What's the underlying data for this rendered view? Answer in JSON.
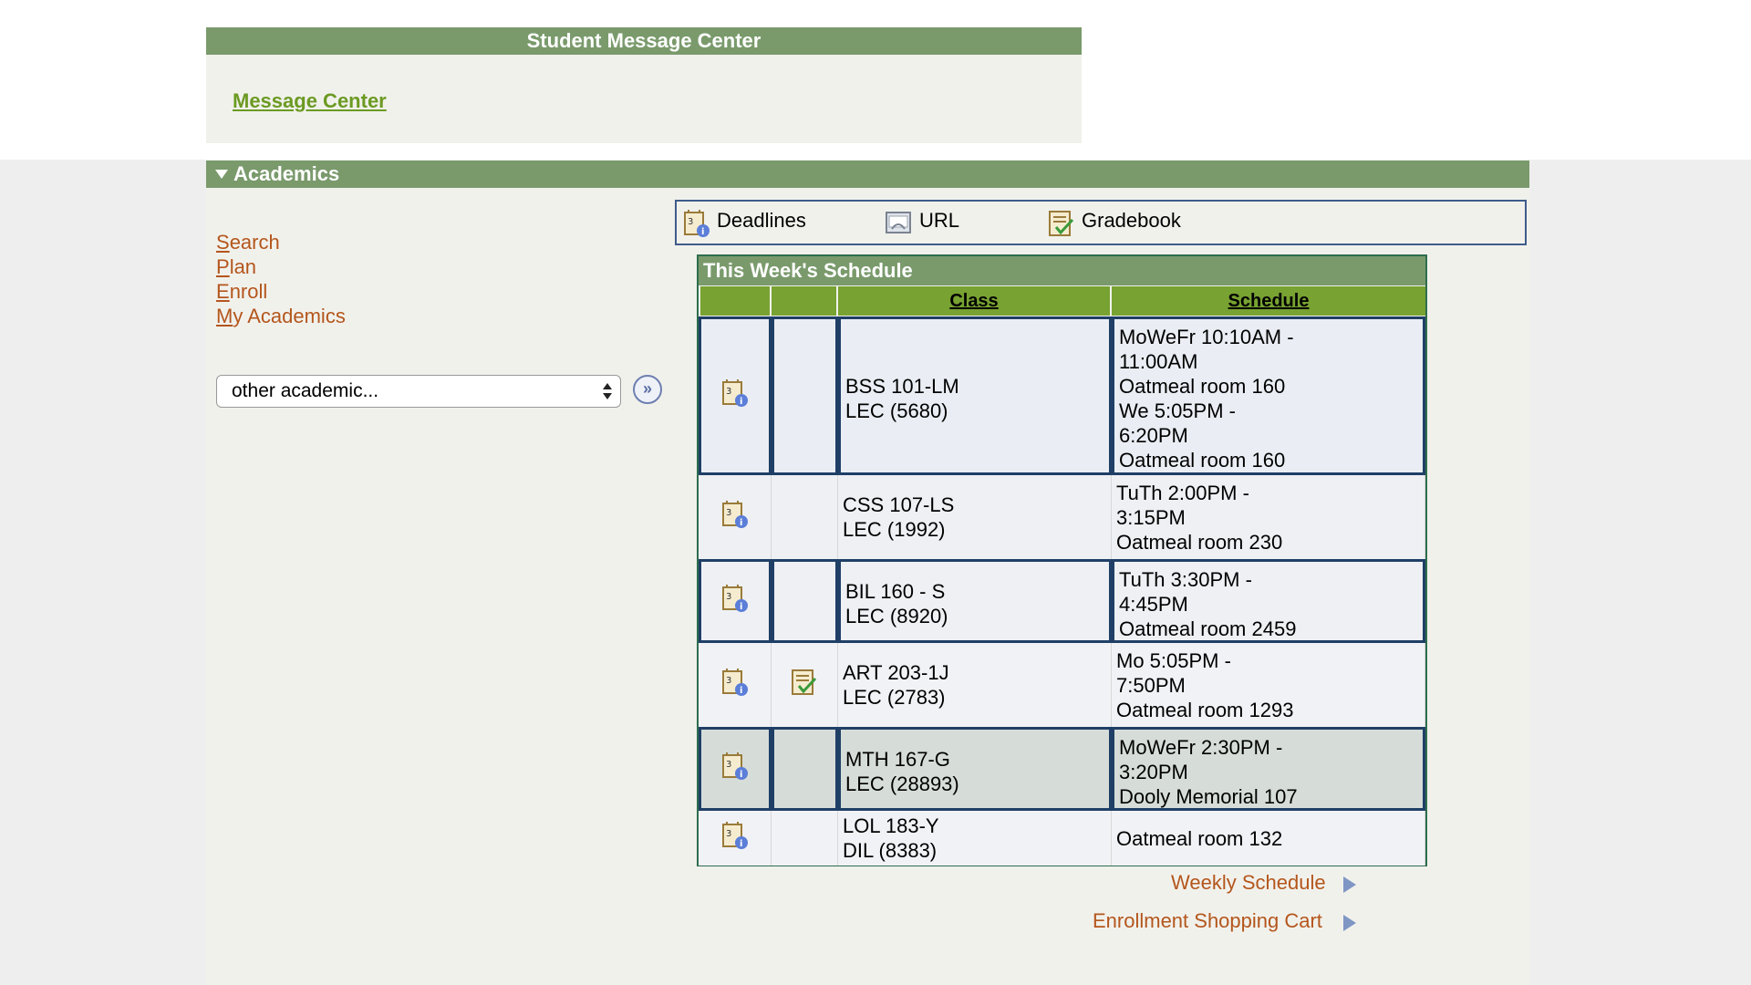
{
  "message_center": {
    "title": "Student Message Center",
    "link": "Message Center"
  },
  "academics": {
    "title": "Academics",
    "nav": [
      {
        "first_letter": "S",
        "rest": "earch"
      },
      {
        "first_letter": "P",
        "rest": "lan"
      },
      {
        "first_letter": "E",
        "rest": "nroll"
      },
      {
        "first_letter": "M",
        "rest": "y Academics"
      }
    ],
    "other_select": "other academic...",
    "go_label": "»"
  },
  "legend": {
    "deadlines": "Deadlines",
    "url": "URL",
    "gradebook": "Gradebook"
  },
  "schedule": {
    "title": "This Week's Schedule",
    "headers": {
      "class": "Class",
      "schedule": "Schedule"
    },
    "rows": [
      {
        "class_lines": [
          "BSS 101-LM",
          "LEC (5680)"
        ],
        "schedule_lines": [
          "MoWeFr 10:10AM -",
          "11:00AM",
          "Oatmeal room 160",
          "We 5:05PM -",
          "6:20PM",
          "Oatmeal room 160"
        ],
        "gradebook": false
      },
      {
        "class_lines": [
          "CSS 107-LS",
          "LEC (1992)"
        ],
        "schedule_lines": [
          "TuTh 2:00PM -",
          "3:15PM",
          "Oatmeal room 230"
        ],
        "gradebook": false
      },
      {
        "class_lines": [
          "BIL 160 - S",
          "LEC (8920)"
        ],
        "schedule_lines": [
          "TuTh 3:30PM -",
          "4:45PM",
          "Oatmeal room 2459"
        ],
        "gradebook": false
      },
      {
        "class_lines": [
          "ART 203-1J",
          "LEC (2783)"
        ],
        "schedule_lines": [
          "Mo 5:05PM -",
          "7:50PM",
          "Oatmeal room 1293"
        ],
        "gradebook": true
      },
      {
        "class_lines": [
          "MTH 167-G",
          "LEC (28893)"
        ],
        "schedule_lines": [
          "MoWeFr 2:30PM -",
          "3:20PM",
          "Dooly Memorial 107"
        ],
        "gradebook": false
      },
      {
        "class_lines": [
          "LOL 183-Y",
          "DIL (8383)"
        ],
        "schedule_lines": [
          "Oatmeal room 132"
        ],
        "gradebook": false
      }
    ]
  },
  "links": {
    "weekly": "Weekly Schedule",
    "cart": "Enrollment Shopping Cart"
  },
  "colors": {
    "header_green": "#7a9a6c",
    "column_header_green": "#78a231",
    "link_orange": "#b4561c",
    "message_link_green": "#6b9a22",
    "row_border_blue": "#1f3f66"
  }
}
